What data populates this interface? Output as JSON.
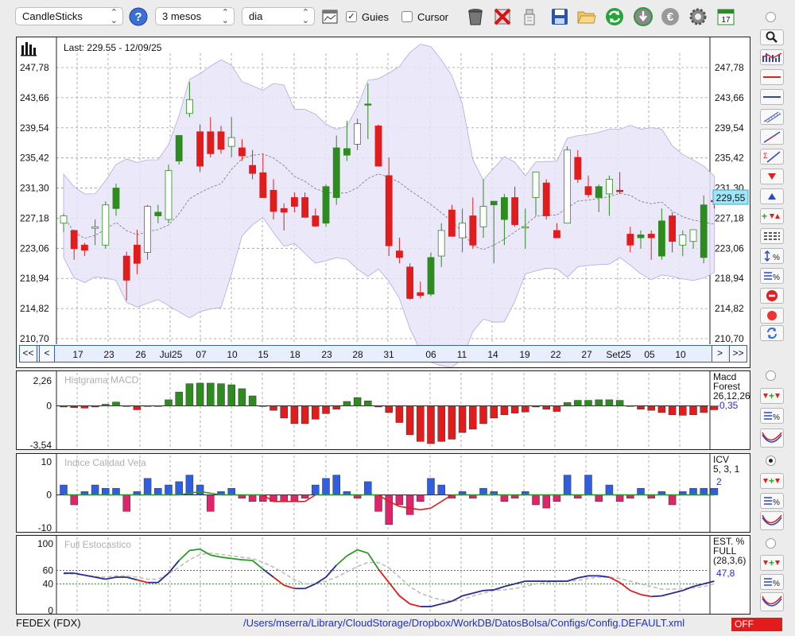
{
  "toolbar": {
    "chart_type": "CandleSticks",
    "period": "3 mesos",
    "interval": "dia",
    "guides_label": "Guies",
    "guides_checked": true,
    "cursor_label": "Cursor",
    "cursor_checked": false,
    "calendar_day": "17",
    "icons": [
      "help-icon",
      "chart-window-icon",
      "trash-icon",
      "delete-icon",
      "broom-icon",
      "save-icon",
      "folder-open-icon",
      "refresh-icon",
      "download-icon",
      "euro-icon",
      "gear-icon",
      "calendar-icon"
    ]
  },
  "price_chart": {
    "last_label": "Last: 229.55 - 12/09/25",
    "y_ticks": [
      "247,78",
      "243,66",
      "239,54",
      "235,42",
      "231,30",
      "227,18",
      "223,06",
      "218,94",
      "214,82",
      "210,70"
    ],
    "current_price_tag": "229,55",
    "nav": {
      "first": "<<",
      "prev": "<",
      "next": ">",
      "last": ">>"
    },
    "x_labels": [
      "17",
      "23",
      "26",
      "Jul25",
      "07",
      "10",
      "15",
      "18",
      "23",
      "28",
      "31",
      "06",
      "11",
      "14",
      "19",
      "22",
      "27",
      "Set25",
      "05",
      "10"
    ],
    "colors": {
      "up": "#2e8b1f",
      "down": "#e01c1c",
      "band_fill": "#e8e4f8",
      "band_edge": "#b3a8e4"
    }
  },
  "macd": {
    "title": "Histgrama MACD",
    "y_ticks": [
      "2,26",
      "0",
      "-3,54"
    ],
    "label_name": "Macd",
    "label_type": "Forest",
    "label_params": "26,12,26",
    "label_value": "-0,35"
  },
  "icv": {
    "title": "Indice Calidad Vela",
    "y_ticks": [
      "10",
      "0",
      "-10"
    ],
    "label_name": "ICV",
    "label_params": "5, 3, 1",
    "label_value": "2"
  },
  "stoch": {
    "title": "Full Estocastico",
    "y_ticks": [
      "100",
      "60",
      "40",
      "0"
    ],
    "label_name": "EST. %",
    "label_type": "FULL",
    "label_params": "(28,3,6)",
    "label_value": "47,8"
  },
  "status": {
    "symbol": "FEDEX (FDX)",
    "path": "/Users/mserra/Library/CloudStorage/Dropbox/WorkDB/DatosBolsa/Configs/Config.DEFAULT.xml",
    "mode": "OFF"
  },
  "chart_data": [
    {
      "type": "candlestick",
      "title": "Last: 229.55 - 12/09/25",
      "ylim": [
        210.7,
        247.78
      ],
      "overlays": [
        "bollinger-band (shaded purple)",
        "moving-average (dashed)"
      ],
      "ohlc": [
        [
          226.5,
          227.8,
          225.3,
          227.5
        ],
        [
          225.5,
          225.6,
          221.5,
          223.0
        ],
        [
          223.5,
          223.8,
          222.0,
          222.8
        ],
        [
          225.8,
          227.0,
          223.5,
          226.0
        ],
        [
          223.5,
          229.5,
          223.0,
          229.0
        ],
        [
          228.5,
          231.9,
          227.5,
          231.3
        ],
        [
          222.0,
          222.6,
          215.9,
          218.7
        ],
        [
          223.5,
          225.6,
          219.5,
          221.0
        ],
        [
          222.5,
          229.0,
          221.5,
          228.8
        ],
        [
          227.5,
          229.0,
          226.5,
          228.0
        ],
        [
          227.0,
          234.5,
          226.5,
          233.7
        ],
        [
          235.0,
          238.0,
          234.5,
          238.5
        ],
        [
          241.5,
          245.8,
          241.0,
          243.4
        ],
        [
          239.0,
          240.0,
          233.5,
          234.3
        ],
        [
          239.0,
          241.0,
          235.5,
          236.0
        ],
        [
          239.0,
          239.8,
          236.0,
          236.6
        ],
        [
          237.0,
          241.0,
          235.5,
          238.2
        ],
        [
          236.8,
          238.0,
          235.0,
          235.7
        ],
        [
          234.4,
          236.5,
          232.5,
          233.3
        ],
        [
          233.4,
          236.0,
          230.0,
          230.0
        ],
        [
          231.0,
          232.5,
          227.0,
          228.1
        ],
        [
          228.5,
          229.2,
          225.5,
          228.0
        ],
        [
          230.0,
          230.7,
          228.0,
          228.8
        ],
        [
          230.0,
          230.7,
          228.0,
          227.3
        ],
        [
          227.5,
          228.5,
          226.0,
          226.1
        ],
        [
          226.5,
          231.8,
          226.0,
          231.5
        ],
        [
          230.0,
          238.5,
          229.0,
          236.8
        ],
        [
          235.8,
          240.5,
          235.0,
          236.7
        ],
        [
          237.3,
          240.8,
          236.5,
          240.1
        ],
        [
          242.8,
          245.6,
          238.0,
          242.8
        ],
        [
          239.8,
          240.0,
          234.3,
          234.3
        ],
        [
          233.0,
          235.5,
          222.0,
          223.4
        ],
        [
          222.7,
          224.5,
          221.0,
          221.8
        ],
        [
          220.5,
          221.0,
          216.0,
          216.2
        ],
        [
          217.0,
          218.5,
          216.2,
          216.6
        ],
        [
          216.8,
          222.5,
          216.5,
          221.8
        ],
        [
          222.0,
          226.5,
          220.5,
          225.5
        ],
        [
          228.3,
          229.0,
          225.5,
          224.7
        ],
        [
          224.5,
          228.5,
          222.5,
          226.5
        ],
        [
          227.5,
          230.0,
          223.0,
          223.5
        ],
        [
          226.0,
          232.5,
          224.5,
          228.8
        ],
        [
          229.0,
          229.5,
          221.0,
          229.5
        ],
        [
          227.0,
          230.5,
          223.5,
          230.0
        ],
        [
          230.0,
          231.5,
          226.0,
          226.3
        ],
        [
          226.0,
          228.5,
          223.0,
          226.0
        ],
        [
          230.0,
          233.5,
          227.5,
          233.5
        ],
        [
          232.0,
          232.5,
          227.0,
          227.5
        ],
        [
          225.5,
          226.5,
          224.5,
          224.5
        ],
        [
          226.5,
          237.0,
          226.5,
          236.5
        ],
        [
          235.5,
          236.5,
          232.0,
          232.5
        ],
        [
          231.5,
          233.0,
          230.0,
          230.4
        ],
        [
          230.0,
          231.8,
          228.0,
          231.5
        ],
        [
          230.5,
          233.0,
          227.5,
          232.5
        ],
        [
          231.0,
          233.5,
          230.5,
          230.8
        ],
        [
          225.0,
          226.0,
          222.5,
          223.5
        ],
        [
          224.5,
          225.5,
          223.0,
          224.9
        ],
        [
          225.0,
          225.5,
          221.5,
          224.5
        ],
        [
          222.0,
          228.5,
          221.5,
          226.8
        ],
        [
          227.5,
          228.0,
          222.5,
          224.0
        ],
        [
          223.5,
          225.5,
          222.0,
          224.9
        ],
        [
          224.0,
          225.5,
          223.0,
          225.6
        ],
        [
          221.8,
          230.3,
          221.0,
          229.0
        ],
        [
          229.6,
          231.0,
          228.5,
          229.5
        ]
      ]
    },
    {
      "type": "bar",
      "title": "Histgrama MACD",
      "ylim": [
        -3.54,
        2.26
      ],
      "values": [
        -0.1,
        -0.15,
        -0.2,
        -0.1,
        0.15,
        0.35,
        0,
        -0.35,
        0,
        0,
        0.55,
        1.25,
        2.0,
        2.05,
        2.05,
        2.0,
        1.9,
        1.55,
        0.9,
        0,
        -0.4,
        -1.1,
        -1.6,
        -1.6,
        -1.2,
        -0.7,
        -0.3,
        0.4,
        0.75,
        0.45,
        -0.1,
        -0.6,
        -1.5,
        -2.6,
        -3.2,
        -3.4,
        -3.2,
        -3.0,
        -2.4,
        -2.1,
        -1.6,
        -1.1,
        -0.8,
        -0.65,
        -0.55,
        -0.1,
        -0.3,
        -0.5,
        0.3,
        0.5,
        0.5,
        0.55,
        0.55,
        0.5,
        0,
        -0.3,
        -0.4,
        -0.6,
        -0.8,
        -0.85,
        -0.8,
        -0.6,
        -0.35
      ]
    },
    {
      "type": "bar",
      "title": "Indice Calidad Vela",
      "ylim": [
        -10,
        10
      ],
      "values": [
        3,
        -3,
        1,
        3,
        2,
        2,
        -5,
        1,
        5,
        2,
        3,
        4,
        6,
        3,
        -5,
        1,
        2,
        -1,
        -2,
        -2,
        -2,
        -2,
        -2,
        -1,
        3,
        5,
        6,
        1,
        -1,
        4,
        -5,
        -9,
        -3,
        -6,
        -2,
        5,
        3,
        -1,
        1,
        -1,
        2,
        1,
        -2,
        -1,
        1,
        -3,
        -4,
        -2,
        6,
        -1,
        6,
        -2,
        3,
        -2,
        -1,
        2,
        -1,
        1,
        -3,
        1,
        2,
        2,
        2
      ],
      "line": [
        0,
        0,
        0,
        0,
        0,
        0,
        0,
        0,
        0,
        0,
        0,
        0,
        0.5,
        1,
        0.5,
        0,
        0,
        0,
        0,
        0,
        -2,
        -2,
        -2,
        -2,
        0,
        0,
        0,
        0,
        0,
        0,
        0,
        -2,
        -3.5,
        -4,
        -4.5,
        -4,
        -2,
        0,
        0,
        0,
        0,
        0,
        0,
        0,
        0,
        0,
        0,
        0,
        0,
        0,
        0,
        0,
        0,
        0,
        0,
        0,
        0,
        0,
        0,
        0,
        0,
        0,
        0
      ]
    },
    {
      "type": "line",
      "title": "Full Estocastico",
      "ylim": [
        0,
        100
      ],
      "levels": [
        60,
        40
      ],
      "series": [
        {
          "values": [
            56,
            56,
            53,
            50,
            47,
            50,
            50,
            46,
            42,
            42,
            56,
            75,
            90,
            92,
            83,
            80,
            78,
            76,
            75,
            62,
            50,
            38,
            33,
            33,
            40,
            50,
            68,
            82,
            91,
            86,
            62,
            42,
            22,
            10,
            6,
            6,
            10,
            14,
            22,
            26,
            30,
            31,
            36,
            40,
            44,
            44,
            44,
            44,
            44,
            49,
            52,
            52,
            50,
            42,
            30,
            24,
            21,
            22,
            26,
            30,
            36,
            40,
            44
          ]
        },
        {
          "values": [
            55,
            55,
            53,
            51,
            50,
            52,
            52,
            50,
            47,
            47,
            55,
            65,
            76,
            84,
            86,
            84,
            82,
            80,
            78,
            72,
            65,
            56,
            46,
            40,
            40,
            44,
            50,
            58,
            66,
            72,
            72,
            64,
            50,
            36,
            26,
            20,
            16,
            14,
            16,
            22,
            26,
            30,
            31,
            33,
            36,
            40,
            42,
            43,
            44,
            45,
            48,
            50,
            50,
            48,
            44,
            40,
            36,
            32,
            32,
            33,
            34,
            36,
            40
          ]
        }
      ]
    }
  ]
}
